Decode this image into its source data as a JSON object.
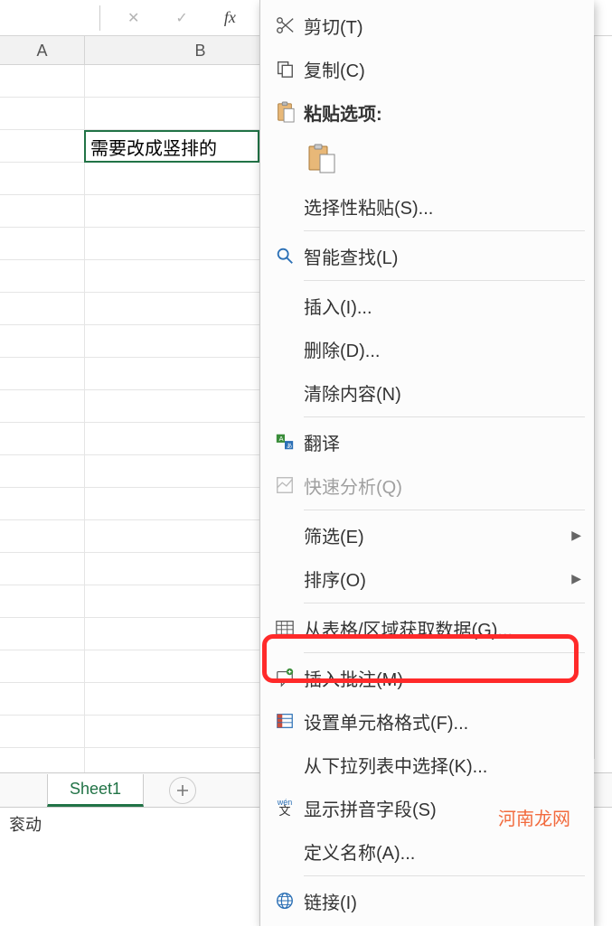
{
  "formula_bar": {
    "cancel": "✕",
    "confirm": "✓",
    "fx": "fx"
  },
  "columns": {
    "A": "A",
    "B": "B"
  },
  "cell_content": "需要改成竖排的",
  "sheet_tab": "Sheet1",
  "status_text": "衮动",
  "watermark": "河南龙网",
  "menu": {
    "cut": "剪切(T)",
    "copy": "复制(C)",
    "paste_options": "粘贴选项:",
    "paste_special": "选择性粘贴(S)...",
    "smart_lookup": "智能查找(L)",
    "insert": "插入(I)...",
    "delete": "删除(D)...",
    "clear": "清除内容(N)",
    "translate": "翻译",
    "quick_analysis": "快速分析(Q)",
    "filter": "筛选(E)",
    "sort": "排序(O)",
    "get_data": "从表格/区域获取数据(G)...",
    "insert_comment": "插入批注(M)",
    "format_cells": "设置单元格格式(F)...",
    "pick_list": "从下拉列表中选择(K)...",
    "show_pinyin": "显示拼音字段(S)",
    "define_name": "定义名称(A)...",
    "link": "链接(I)"
  }
}
